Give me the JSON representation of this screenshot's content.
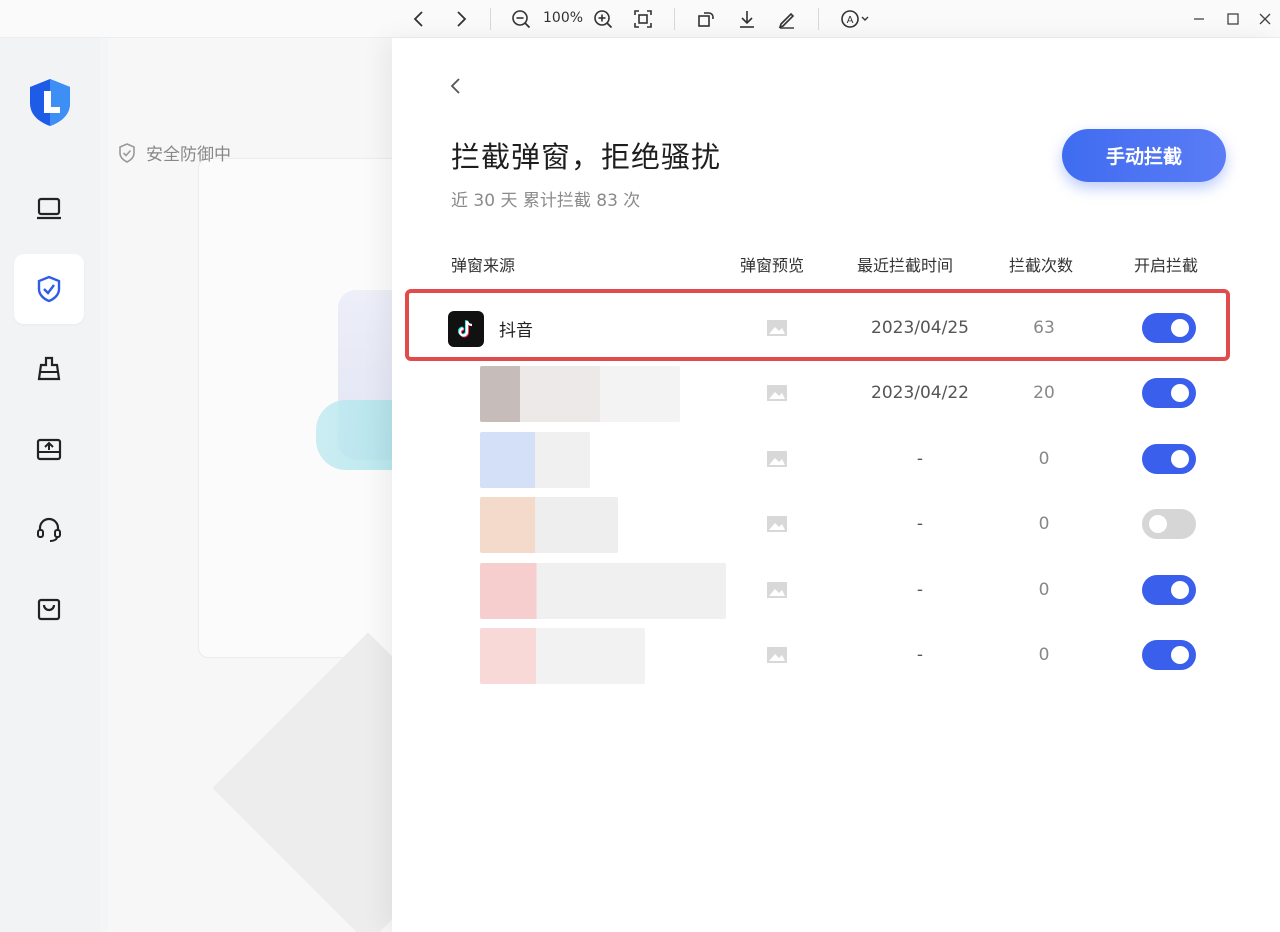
{
  "toolbar": {
    "zoom": "100%",
    "icons": [
      "chevron-left-icon",
      "chevron-right-icon",
      "zoom-out-icon",
      "zoom-in-icon",
      "fit-screen-icon",
      "rotate-icon",
      "download-icon",
      "edit-pen-icon",
      "auto-annotate-icon",
      "minimize-icon",
      "maximize-icon",
      "close-icon"
    ]
  },
  "sidebar": {
    "items": [
      {
        "name": "computer",
        "icon": "monitor-icon"
      },
      {
        "name": "protection",
        "icon": "shield-check-icon",
        "active": true
      },
      {
        "name": "cleanup",
        "icon": "brush-icon"
      },
      {
        "name": "software",
        "icon": "upload-box-icon"
      },
      {
        "name": "support",
        "icon": "headset-icon"
      },
      {
        "name": "store",
        "icon": "bag-icon"
      }
    ]
  },
  "background": {
    "status_label": "安全防御中"
  },
  "panel": {
    "title": "拦截弹窗，拒绝骚扰",
    "subtitle": "近 30 天 累计拦截 83 次",
    "manual_button": "手动拦截",
    "columns": {
      "source": "弹窗来源",
      "preview": "弹窗预览",
      "last_time": "最近拦截时间",
      "count": "拦截次数",
      "enable": "开启拦截"
    },
    "rows": [
      {
        "source": "抖音",
        "last_time": "2023/04/25",
        "count": "63",
        "enabled": true
      },
      {
        "source": "",
        "last_time": "2023/04/22",
        "count": "20",
        "enabled": true
      },
      {
        "source": "",
        "last_time": "-",
        "count": "0",
        "enabled": true
      },
      {
        "source": "",
        "last_time": "-",
        "count": "0",
        "enabled": false
      },
      {
        "source": "",
        "last_time": "-",
        "count": "0",
        "enabled": true
      },
      {
        "source": "",
        "last_time": "-",
        "count": "0",
        "enabled": true
      }
    ]
  },
  "colors": {
    "accent": "#3a5fec",
    "highlight": "#e14b4b",
    "toggle_off": "#d6d6d6"
  }
}
